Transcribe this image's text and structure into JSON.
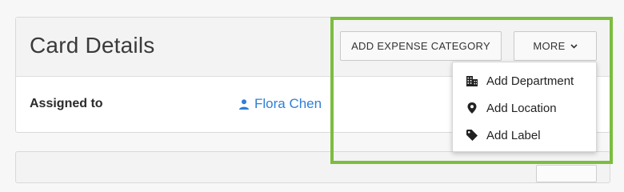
{
  "card": {
    "title": "Card Details",
    "assigned_label": "Assigned to",
    "assignee_name": "Flora Chen"
  },
  "toolbar": {
    "add_category_label": "ADD EXPENSE CATEGORY",
    "more_label": "MORE"
  },
  "menu": {
    "items": [
      {
        "label": "Add Department",
        "icon": "building-icon"
      },
      {
        "label": "Add Location",
        "icon": "location-pin-icon"
      },
      {
        "label": "Add Label",
        "icon": "tag-icon"
      }
    ]
  },
  "colors": {
    "link": "#2f7fd6",
    "highlight": "#7cbd3e"
  }
}
